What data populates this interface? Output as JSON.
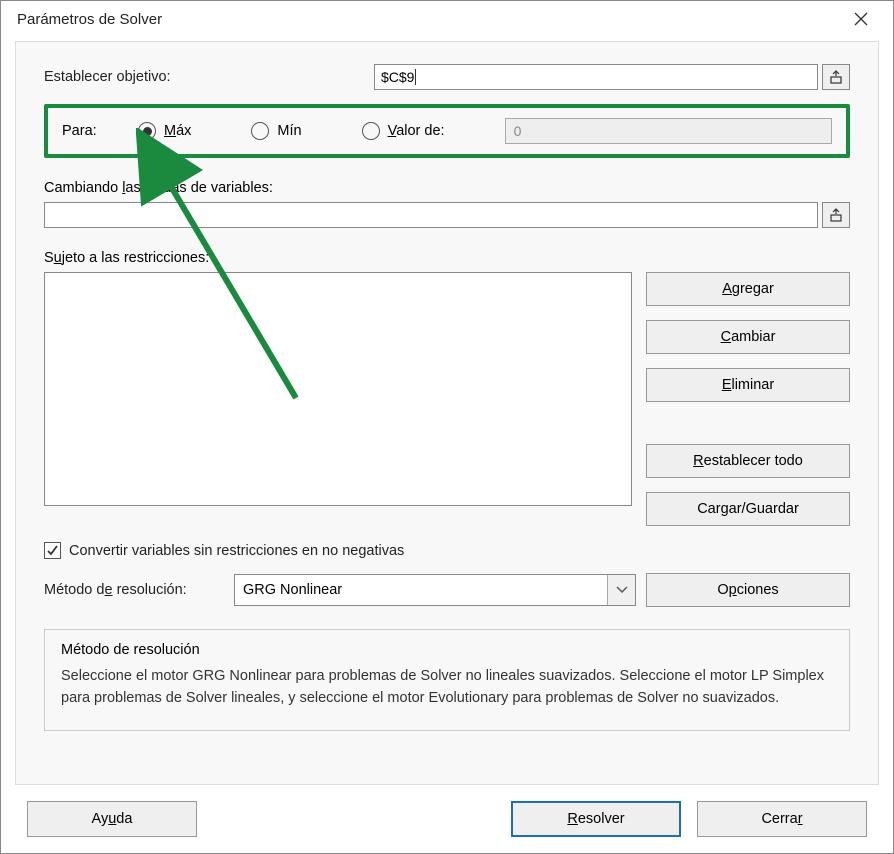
{
  "title": "Parámetros de Solver",
  "objective": {
    "label": "Establecer objetivo:",
    "value": "$C$9"
  },
  "to": {
    "label": "Para:",
    "max": "Máx",
    "min": "Mín",
    "valueOf": "Valor de:",
    "valueInput": "0",
    "selected": "max"
  },
  "vars": {
    "label": "Cambiando las celdas de variables:",
    "value": ""
  },
  "constraints": {
    "label": "Sujeto a las restricciones:",
    "items": []
  },
  "buttons": {
    "add": "Agregar",
    "change": "Cambiar",
    "delete": "Eliminar",
    "resetAll": "Restablecer todo",
    "loadSave": "Cargar/Guardar",
    "options": "Opciones",
    "help": "Ayuda",
    "solve": "Resolver",
    "close": "Cerrar"
  },
  "nonneg": {
    "checked": true,
    "label": "Convertir variables sin restricciones en no negativas"
  },
  "method": {
    "label": "Método de resolución:",
    "selected": "GRG Nonlinear"
  },
  "info": {
    "title": "Método de resolución",
    "text": "Seleccione el motor GRG Nonlinear para problemas de Solver no lineales suavizados. Seleccione el motor LP Simplex para problemas de Solver lineales, y seleccione el motor Evolutionary para problemas de Solver no suavizados."
  }
}
